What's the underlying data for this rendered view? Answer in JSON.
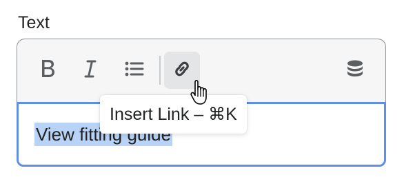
{
  "field": {
    "label": "Text"
  },
  "toolbar": {
    "buttons": [
      {
        "label": "B",
        "icon": "bold-icon"
      },
      {
        "label": "I",
        "icon": "italic-icon"
      },
      {
        "icon": "bulleted-list-icon"
      },
      {
        "icon": "link-icon",
        "state": "hovered"
      },
      {
        "icon": "database-icon"
      }
    ]
  },
  "editor": {
    "content": "View fitting guide",
    "selection_color": "#b9d3f6",
    "focus_color": "#5e8ee8"
  },
  "tooltip": {
    "text": "Insert Link – ⌘K"
  },
  "cursor": {
    "icon": "hand-pointer-icon"
  }
}
